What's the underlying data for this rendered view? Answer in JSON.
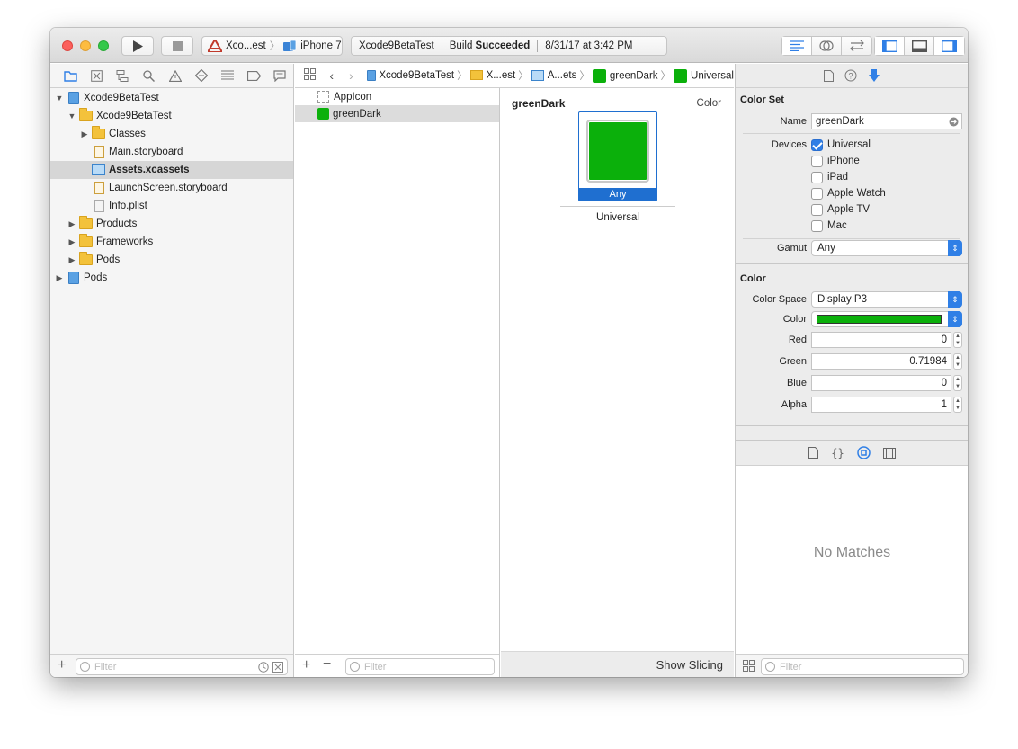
{
  "toolbar": {
    "scheme": "Xco...est",
    "device": "iPhone 7",
    "activity_project": "Xcode9BetaTest",
    "activity_status_prefix": "Build ",
    "activity_status": "Succeeded",
    "activity_time": "8/31/17 at 3:42 PM"
  },
  "navigator": {
    "tree": [
      {
        "label": "Xcode9BetaTest"
      },
      {
        "label": "Xcode9BetaTest"
      },
      {
        "label": "Classes"
      },
      {
        "label": "Main.storyboard"
      },
      {
        "label": "Assets.xcassets"
      },
      {
        "label": "LaunchScreen.storyboard"
      },
      {
        "label": "Info.plist"
      },
      {
        "label": "Products"
      },
      {
        "label": "Frameworks"
      },
      {
        "label": "Pods"
      },
      {
        "label": "Pods"
      }
    ],
    "filter_placeholder": "Filter"
  },
  "jumpbar": [
    "Xcode9BetaTest",
    "X...est",
    "A...ets",
    "greenDark",
    "Universal"
  ],
  "assets": {
    "items": [
      "AppIcon",
      "greenDark"
    ],
    "filter_placeholder": "Filter"
  },
  "editor": {
    "title": "greenDark",
    "type": "Color",
    "well_label": "Any",
    "caption": "Universal",
    "footer_button": "Show Slicing"
  },
  "inspector": {
    "color_set_title": "Color Set",
    "name_label": "Name",
    "name_value": "greenDark",
    "devices_label": "Devices",
    "devices": [
      {
        "label": "Universal",
        "checked": true
      },
      {
        "label": "iPhone",
        "checked": false
      },
      {
        "label": "iPad",
        "checked": false
      },
      {
        "label": "Apple Watch",
        "checked": false
      },
      {
        "label": "Apple TV",
        "checked": false
      },
      {
        "label": "Mac",
        "checked": false
      }
    ],
    "gamut_label": "Gamut",
    "gamut_value": "Any",
    "color_title": "Color",
    "color_space_label": "Color Space",
    "color_space_value": "Display P3",
    "color_label": "Color",
    "red_label": "Red",
    "red_value": "0",
    "green_label": "Green",
    "green_value": "0.71984",
    "blue_label": "Blue",
    "blue_value": "0",
    "alpha_label": "Alpha",
    "alpha_value": "1",
    "no_matches": "No Matches",
    "filter_placeholder": "Filter"
  },
  "colors": {
    "swatch": "#0bb00b",
    "accent": "#2f7fe6"
  }
}
